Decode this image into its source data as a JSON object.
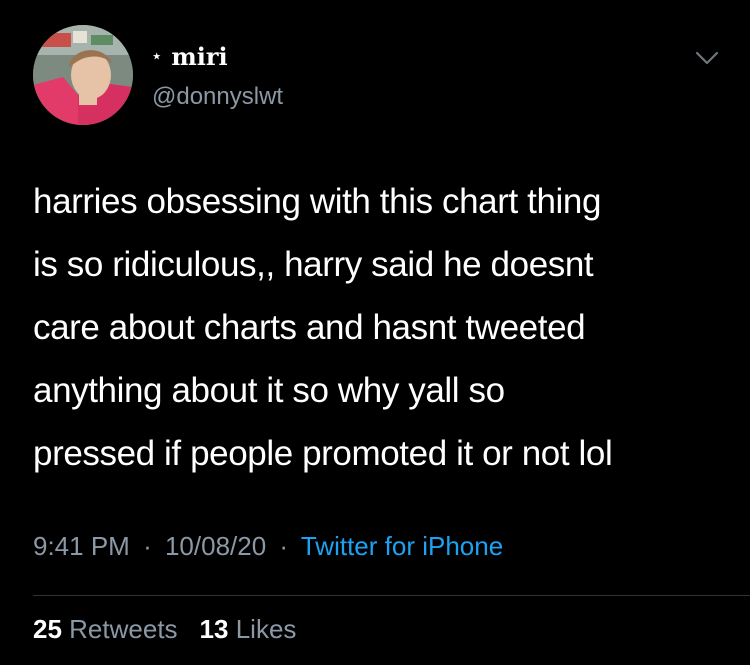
{
  "tweet": {
    "author": {
      "display_name": "miri",
      "name_prefix": "⋆",
      "handle": "@donnyslwt"
    },
    "text_lines": [
      "harries obsessing with this chart thing",
      "is so ridiculous,, harry said he doesnt",
      "care about charts and hasnt tweeted",
      "anything about it so why yall so",
      "pressed if people promoted it or not lol"
    ],
    "time": "9:41 PM",
    "date": "10/08/20",
    "separator": "·",
    "source": "Twitter for iPhone",
    "stats": {
      "retweets_count": "25",
      "retweets_label": "Retweets",
      "likes_count": "13",
      "likes_label": "Likes"
    }
  },
  "icons": {
    "caret": "chevron-down-icon",
    "avatar": "avatar"
  },
  "colors": {
    "background": "#000000",
    "primary_text": "#ffffff",
    "secondary_text": "#8b98a5",
    "link": "#1da1f2",
    "divider": "#2f3336"
  }
}
